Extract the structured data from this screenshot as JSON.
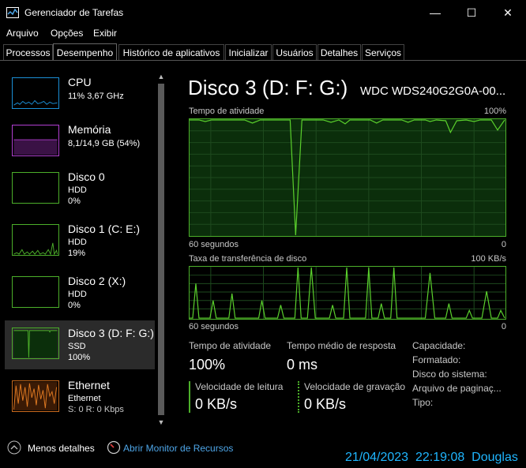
{
  "window": {
    "title": "Gerenciador de Tarefas",
    "minimize_glyph": "—",
    "maximize_glyph": "☐",
    "close_glyph": "✕"
  },
  "menu": [
    "Arquivo",
    "Opções",
    "Exibir"
  ],
  "tabs": [
    "Processos",
    "Desempenho",
    "Histórico de aplicativos",
    "Inicializar",
    "Usuários",
    "Detalhes",
    "Serviços"
  ],
  "active_tab": "Desempenho",
  "sidebar": [
    {
      "name": "CPU",
      "line1": "11% 3,67 GHz",
      "line2": "",
      "color": "#1b8fd6"
    },
    {
      "name": "Memória",
      "line1": "8,1/14,9 GB (54%)",
      "line2": "",
      "color": "#b13ed1"
    },
    {
      "name": "Disco 0",
      "line1": "HDD",
      "line2": "0%",
      "color": "#4caf2a"
    },
    {
      "name": "Disco 1 (C: E:)",
      "line1": "HDD",
      "line2": "19%",
      "color": "#4caf2a"
    },
    {
      "name": "Disco 2 (X:)",
      "line1": "HDD",
      "line2": "0%",
      "color": "#4caf2a"
    },
    {
      "name": "Disco 3 (D: F: G:)",
      "line1": "SSD",
      "line2": "100%",
      "color": "#4caf2a"
    },
    {
      "name": "Ethernet",
      "line1": "Ethernet",
      "line2": "S: 0 R: 0 Kbps",
      "color": "#c8691c"
    }
  ],
  "detail": {
    "title": "Disco 3 (D: F: G:)",
    "model": "WDC WDS240G2G0A-00...",
    "graph1": {
      "label": "Tempo de atividade",
      "max": "100%",
      "time": "60 segundos",
      "min": "0"
    },
    "graph2": {
      "label": "Taxa de transferência de disco",
      "max": "100 KB/s",
      "time": "60 segundos",
      "min": "0"
    },
    "stats": {
      "active_time_label": "Tempo de atividade",
      "active_time_value": "100%",
      "response_label": "Tempo médio de resposta",
      "response_value": "0 ms",
      "read_label": "Velocidade de leitura",
      "read_value": "0 KB/s",
      "write_label": "Velocidade de gravação",
      "write_value": "0 KB/s"
    },
    "properties": [
      "Capacidade:",
      "Formatado:",
      "Disco do sistema:",
      "Arquivo de paginaç...",
      "Tipo:"
    ]
  },
  "footer": {
    "less_details": "Menos detalhes",
    "resource_monitor": "Abrir Monitor de Recursos",
    "clock": "21/04/2023  22:19:08  Douglas"
  },
  "colors": {
    "accent_disk": "#4caf2a",
    "link": "#4ea6e8",
    "clock": "#1fb6ff"
  }
}
